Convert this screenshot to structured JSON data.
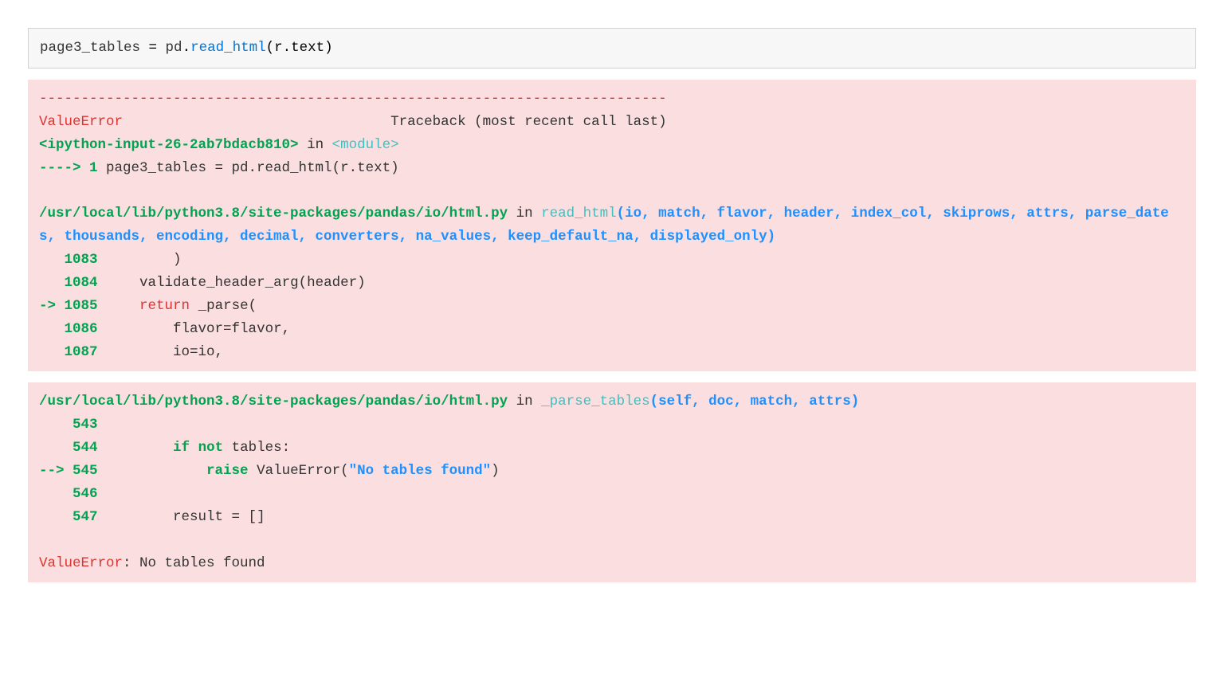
{
  "input": {
    "var": "page3_tables",
    "eq": " = ",
    "pd": "pd",
    "dot1": ".",
    "read": "read_html",
    "open": "(",
    "r": "r",
    "dot2": ".",
    "text": "text",
    "close": ")"
  },
  "tb": {
    "hr": "---------------------------------------------------------------------------",
    "err_name": "ValueError",
    "err_spacer": "                               ",
    "tb_label": " Traceback (most recent call last)",
    "ipy_src": "<ipython-input-26-2ab7bdacb810>",
    "in": " in ",
    "module": "<module>",
    "arrow1": "----> 1",
    "line1_post": " page3_tables = pd.read_html(r.text)",
    "blank": "",
    "file1": "/usr/local/lib/python3.8/site-packages/pandas/io/html.py",
    "in1": " in ",
    "func1a": "read_html",
    "func1b": "(io, match, flavor, header, index_col, skiprows, attrs, parse_dates, thousands, encoding, decimal, converters, na_values, keep_default_na, displayed_only)",
    "l1083_pre": "   ",
    "l1083_num": "1083",
    "l1083_code": "         )",
    "l1084_pre": "   ",
    "l1084_num": "1084",
    "l1084_code": "     validate_header_arg(header)",
    "l1085_arrow": "-> ",
    "l1085_num": "1085",
    "l1085_ret": "     return",
    "l1085_call": " _parse",
    "l1085_paren": "(",
    "l1086_pre": "   ",
    "l1086_num": "1086",
    "l1086_code": "         flavor=flavor,",
    "l1087_pre": "   ",
    "l1087_num": "1087",
    "l1087_code": "         io=io,"
  },
  "tb2": {
    "file2": "/usr/local/lib/python3.8/site-packages/pandas/io/html.py",
    "in2": " in ",
    "func2a": "_parse_tables",
    "func2b": "(self, doc, match, attrs)",
    "l543_pre": "    ",
    "l543_num": "543",
    "l543_code": " ",
    "l544_pre": "    ",
    "l544_num": "544",
    "l544_if": "         if",
    "l544_not": " not",
    "l544_post": " tables:",
    "l545_arrow": "--> ",
    "l545_num": "545",
    "l545_raise": "             raise",
    "l545_post": " ValueError(",
    "l545_str": "\"No tables found\"",
    "l545_close": ")",
    "l546_pre": "    ",
    "l546_num": "546",
    "l546_code": " ",
    "l547_pre": "    ",
    "l547_num": "547",
    "l547_code": "         result = []",
    "final_err": "ValueError",
    "final_msg": ": No tables found"
  }
}
